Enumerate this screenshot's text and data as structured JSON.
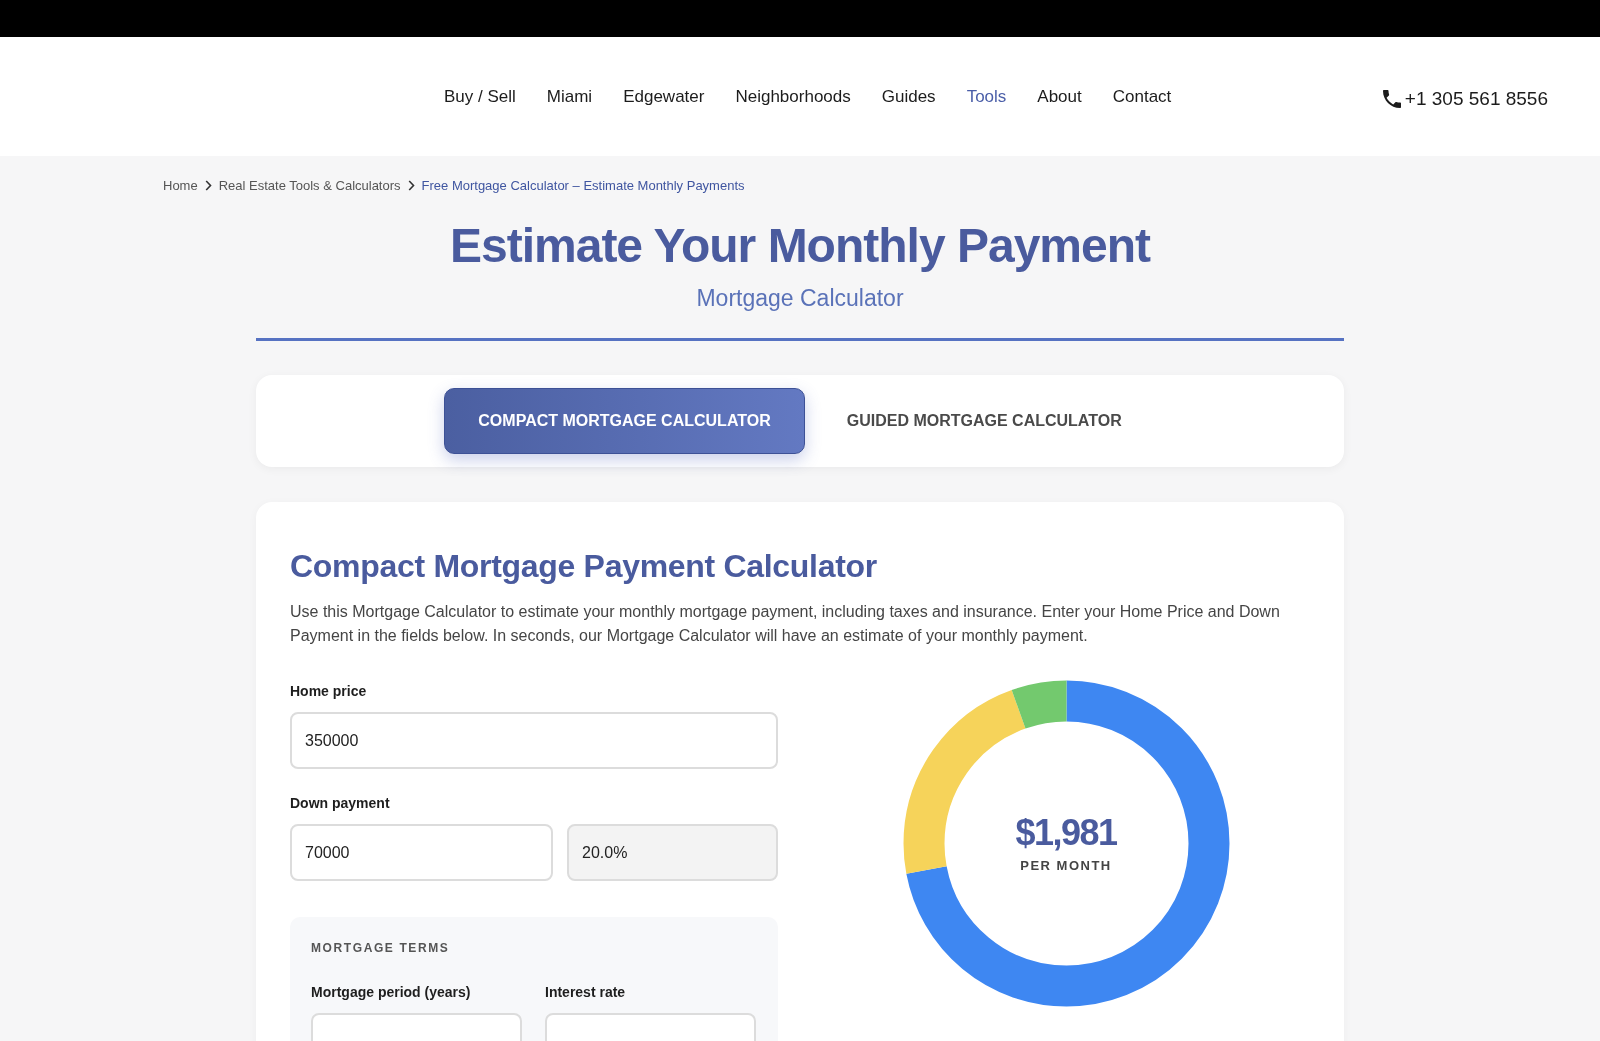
{
  "header": {
    "nav": [
      {
        "label": "Buy / Sell",
        "selected": false
      },
      {
        "label": "Miami",
        "selected": false
      },
      {
        "label": "Edgewater",
        "selected": false
      },
      {
        "label": "Neighborhoods",
        "selected": false
      },
      {
        "label": "Guides",
        "selected": false
      },
      {
        "label": "Tools",
        "selected": true
      },
      {
        "label": "About",
        "selected": false
      },
      {
        "label": "Contact",
        "selected": false
      }
    ],
    "phone": "+1 305 561 8556"
  },
  "breadcrumb": [
    {
      "label": "Home",
      "current": false
    },
    {
      "label": "Real Estate Tools & Calculators",
      "current": false
    },
    {
      "label": "Free Mortgage Calculator – Estimate Monthly Payments",
      "current": true
    }
  ],
  "hero": {
    "title": "Estimate Your Monthly Payment",
    "subtitle": "Mortgage Calculator"
  },
  "tabs": [
    {
      "label": "COMPACT MORTGAGE CALCULATOR",
      "selected": true
    },
    {
      "label": "GUIDED MORTGAGE CALCULATOR",
      "selected": false
    }
  ],
  "calculator": {
    "title": "Compact Mortgage Payment Calculator",
    "description": "Use this Mortgage Calculator to estimate your monthly mortgage payment, including taxes and insurance. Enter your Home Price and Down Payment in the fields below. In seconds, our Mortgage Calculator will have an estimate of your monthly payment.",
    "home_price": {
      "label": "Home price",
      "value": "350000"
    },
    "down_payment": {
      "label": "Down payment",
      "inputs": [
        {
          "value": "70000",
          "readonly": false
        },
        {
          "value": "20.0%",
          "readonly": true
        }
      ]
    },
    "mortgage_terms": {
      "heading": "MORTGAGE TERMS",
      "fields": [
        {
          "label": "Mortgage period (years)"
        },
        {
          "label": "Interest rate"
        }
      ]
    },
    "summary": {
      "amount": "$1,981",
      "caption": "PER MONTH"
    }
  }
}
